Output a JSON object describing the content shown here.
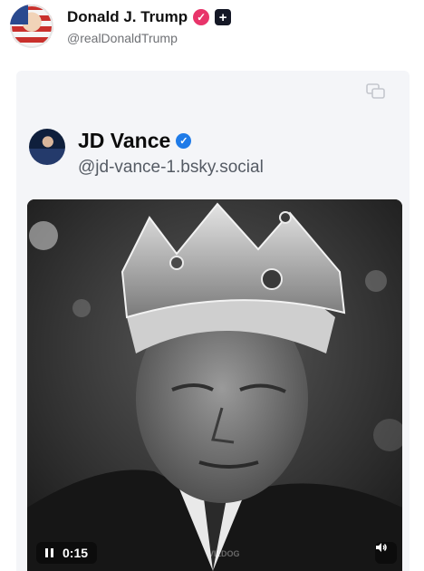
{
  "outer_post": {
    "name": "Donald J. Trump",
    "handle": "@realDonaldTrump",
    "badge_color": "#e8346a",
    "plus_badge_icon": "plus-icon"
  },
  "quoted_post": {
    "name": "JD Vance",
    "handle": "@jd-vance-1.bsky.social",
    "verified_color": "#1f7be8",
    "corner_icon": "repost-icon"
  },
  "video": {
    "time": "0:15",
    "state": "playing",
    "watermark": "VILDOG",
    "volume_icon": "speaker-icon"
  }
}
